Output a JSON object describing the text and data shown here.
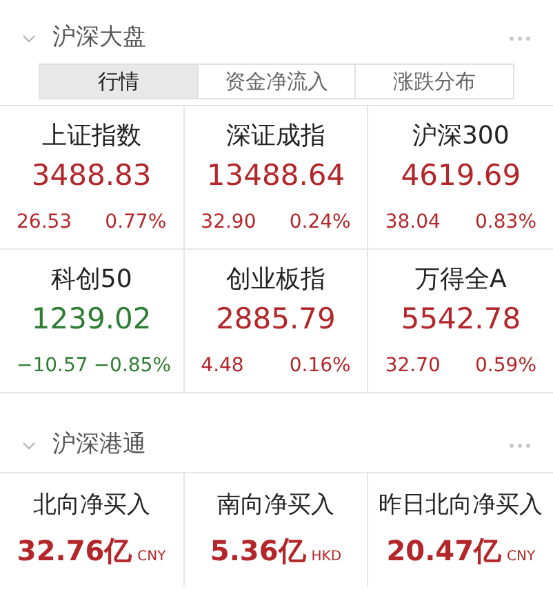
{
  "sections": [
    {
      "title": "沪深大盘",
      "expanded": true,
      "tabs": [
        {
          "label": "行情",
          "selected": true
        },
        {
          "label": "资金净流入",
          "selected": false
        },
        {
          "label": "涨跌分布",
          "selected": false
        }
      ],
      "cards": [
        {
          "kind": "index",
          "color": "#b3262a",
          "name": "上证指数",
          "value": "3488.83",
          "change": "26.53",
          "percent": "0.77%"
        },
        {
          "kind": "index",
          "color": "#b3262a",
          "name": "深证成指",
          "value": "13488.64",
          "change": "32.90",
          "percent": "0.24%"
        },
        {
          "kind": "index",
          "color": "#b3262a",
          "name": "沪深300",
          "value": "4619.69",
          "change": "38.04",
          "percent": "0.83%"
        },
        {
          "kind": "index",
          "color": "#2e7d32",
          "name": "科创50",
          "value": "1239.02",
          "change": "−10.57",
          "percent": "−0.85%"
        },
        {
          "kind": "index",
          "color": "#b3262a",
          "name": "创业板指",
          "value": "2885.79",
          "change": "4.48",
          "percent": "0.16%"
        },
        {
          "kind": "index",
          "color": "#b3262a",
          "name": "万得全A",
          "value": "5542.78",
          "change": "32.70",
          "percent": "0.59%"
        }
      ]
    },
    {
      "title": "沪深港通",
      "expanded": true,
      "cards": [
        {
          "kind": "flow",
          "color": "#b3262a",
          "name": "北向净买入",
          "value": "32.76亿",
          "unit": "CNY"
        },
        {
          "kind": "flow",
          "color": "#b3262a",
          "name": "南向净买入",
          "value": "5.36亿",
          "unit": "HKD"
        },
        {
          "kind": "flow",
          "color": "#b3262a",
          "name": "昨日北向净买入",
          "value": "20.47亿",
          "unit": "CNY"
        }
      ]
    }
  ]
}
